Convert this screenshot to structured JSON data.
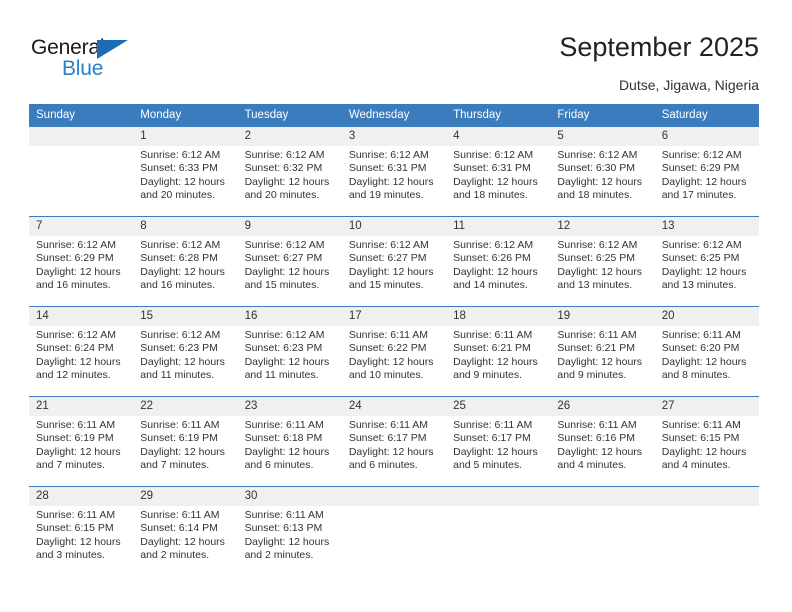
{
  "brand": {
    "name_top": "General",
    "name_bottom": "Blue",
    "triangle_color": "#1b6cb5",
    "text_color": "#2a7fc9"
  },
  "header": {
    "title": "September 2025",
    "subtitle": "Dutse, Jigawa, Nigeria"
  },
  "theme": {
    "header_bg": "#3a7cbe",
    "daynum_bg": "#f0f0f0",
    "text": "#333333"
  },
  "weekday_headers": [
    "Sunday",
    "Monday",
    "Tuesday",
    "Wednesday",
    "Thursday",
    "Friday",
    "Saturday"
  ],
  "weeks": [
    [
      {
        "day": "",
        "sunrise": "",
        "sunset": "",
        "daylight1": "",
        "daylight2": ""
      },
      {
        "day": "1",
        "sunrise": "Sunrise: 6:12 AM",
        "sunset": "Sunset: 6:33 PM",
        "daylight1": "Daylight: 12 hours",
        "daylight2": "and 20 minutes."
      },
      {
        "day": "2",
        "sunrise": "Sunrise: 6:12 AM",
        "sunset": "Sunset: 6:32 PM",
        "daylight1": "Daylight: 12 hours",
        "daylight2": "and 20 minutes."
      },
      {
        "day": "3",
        "sunrise": "Sunrise: 6:12 AM",
        "sunset": "Sunset: 6:31 PM",
        "daylight1": "Daylight: 12 hours",
        "daylight2": "and 19 minutes."
      },
      {
        "day": "4",
        "sunrise": "Sunrise: 6:12 AM",
        "sunset": "Sunset: 6:31 PM",
        "daylight1": "Daylight: 12 hours",
        "daylight2": "and 18 minutes."
      },
      {
        "day": "5",
        "sunrise": "Sunrise: 6:12 AM",
        "sunset": "Sunset: 6:30 PM",
        "daylight1": "Daylight: 12 hours",
        "daylight2": "and 18 minutes."
      },
      {
        "day": "6",
        "sunrise": "Sunrise: 6:12 AM",
        "sunset": "Sunset: 6:29 PM",
        "daylight1": "Daylight: 12 hours",
        "daylight2": "and 17 minutes."
      }
    ],
    [
      {
        "day": "7",
        "sunrise": "Sunrise: 6:12 AM",
        "sunset": "Sunset: 6:29 PM",
        "daylight1": "Daylight: 12 hours",
        "daylight2": "and 16 minutes."
      },
      {
        "day": "8",
        "sunrise": "Sunrise: 6:12 AM",
        "sunset": "Sunset: 6:28 PM",
        "daylight1": "Daylight: 12 hours",
        "daylight2": "and 16 minutes."
      },
      {
        "day": "9",
        "sunrise": "Sunrise: 6:12 AM",
        "sunset": "Sunset: 6:27 PM",
        "daylight1": "Daylight: 12 hours",
        "daylight2": "and 15 minutes."
      },
      {
        "day": "10",
        "sunrise": "Sunrise: 6:12 AM",
        "sunset": "Sunset: 6:27 PM",
        "daylight1": "Daylight: 12 hours",
        "daylight2": "and 15 minutes."
      },
      {
        "day": "11",
        "sunrise": "Sunrise: 6:12 AM",
        "sunset": "Sunset: 6:26 PM",
        "daylight1": "Daylight: 12 hours",
        "daylight2": "and 14 minutes."
      },
      {
        "day": "12",
        "sunrise": "Sunrise: 6:12 AM",
        "sunset": "Sunset: 6:25 PM",
        "daylight1": "Daylight: 12 hours",
        "daylight2": "and 13 minutes."
      },
      {
        "day": "13",
        "sunrise": "Sunrise: 6:12 AM",
        "sunset": "Sunset: 6:25 PM",
        "daylight1": "Daylight: 12 hours",
        "daylight2": "and 13 minutes."
      }
    ],
    [
      {
        "day": "14",
        "sunrise": "Sunrise: 6:12 AM",
        "sunset": "Sunset: 6:24 PM",
        "daylight1": "Daylight: 12 hours",
        "daylight2": "and 12 minutes."
      },
      {
        "day": "15",
        "sunrise": "Sunrise: 6:12 AM",
        "sunset": "Sunset: 6:23 PM",
        "daylight1": "Daylight: 12 hours",
        "daylight2": "and 11 minutes."
      },
      {
        "day": "16",
        "sunrise": "Sunrise: 6:12 AM",
        "sunset": "Sunset: 6:23 PM",
        "daylight1": "Daylight: 12 hours",
        "daylight2": "and 11 minutes."
      },
      {
        "day": "17",
        "sunrise": "Sunrise: 6:11 AM",
        "sunset": "Sunset: 6:22 PM",
        "daylight1": "Daylight: 12 hours",
        "daylight2": "and 10 minutes."
      },
      {
        "day": "18",
        "sunrise": "Sunrise: 6:11 AM",
        "sunset": "Sunset: 6:21 PM",
        "daylight1": "Daylight: 12 hours",
        "daylight2": "and 9 minutes."
      },
      {
        "day": "19",
        "sunrise": "Sunrise: 6:11 AM",
        "sunset": "Sunset: 6:21 PM",
        "daylight1": "Daylight: 12 hours",
        "daylight2": "and 9 minutes."
      },
      {
        "day": "20",
        "sunrise": "Sunrise: 6:11 AM",
        "sunset": "Sunset: 6:20 PM",
        "daylight1": "Daylight: 12 hours",
        "daylight2": "and 8 minutes."
      }
    ],
    [
      {
        "day": "21",
        "sunrise": "Sunrise: 6:11 AM",
        "sunset": "Sunset: 6:19 PM",
        "daylight1": "Daylight: 12 hours",
        "daylight2": "and 7 minutes."
      },
      {
        "day": "22",
        "sunrise": "Sunrise: 6:11 AM",
        "sunset": "Sunset: 6:19 PM",
        "daylight1": "Daylight: 12 hours",
        "daylight2": "and 7 minutes."
      },
      {
        "day": "23",
        "sunrise": "Sunrise: 6:11 AM",
        "sunset": "Sunset: 6:18 PM",
        "daylight1": "Daylight: 12 hours",
        "daylight2": "and 6 minutes."
      },
      {
        "day": "24",
        "sunrise": "Sunrise: 6:11 AM",
        "sunset": "Sunset: 6:17 PM",
        "daylight1": "Daylight: 12 hours",
        "daylight2": "and 6 minutes."
      },
      {
        "day": "25",
        "sunrise": "Sunrise: 6:11 AM",
        "sunset": "Sunset: 6:17 PM",
        "daylight1": "Daylight: 12 hours",
        "daylight2": "and 5 minutes."
      },
      {
        "day": "26",
        "sunrise": "Sunrise: 6:11 AM",
        "sunset": "Sunset: 6:16 PM",
        "daylight1": "Daylight: 12 hours",
        "daylight2": "and 4 minutes."
      },
      {
        "day": "27",
        "sunrise": "Sunrise: 6:11 AM",
        "sunset": "Sunset: 6:15 PM",
        "daylight1": "Daylight: 12 hours",
        "daylight2": "and 4 minutes."
      }
    ],
    [
      {
        "day": "28",
        "sunrise": "Sunrise: 6:11 AM",
        "sunset": "Sunset: 6:15 PM",
        "daylight1": "Daylight: 12 hours",
        "daylight2": "and 3 minutes."
      },
      {
        "day": "29",
        "sunrise": "Sunrise: 6:11 AM",
        "sunset": "Sunset: 6:14 PM",
        "daylight1": "Daylight: 12 hours",
        "daylight2": "and 2 minutes."
      },
      {
        "day": "30",
        "sunrise": "Sunrise: 6:11 AM",
        "sunset": "Sunset: 6:13 PM",
        "daylight1": "Daylight: 12 hours",
        "daylight2": "and 2 minutes."
      },
      {
        "day": "",
        "sunrise": "",
        "sunset": "",
        "daylight1": "",
        "daylight2": ""
      },
      {
        "day": "",
        "sunrise": "",
        "sunset": "",
        "daylight1": "",
        "daylight2": ""
      },
      {
        "day": "",
        "sunrise": "",
        "sunset": "",
        "daylight1": "",
        "daylight2": ""
      },
      {
        "day": "",
        "sunrise": "",
        "sunset": "",
        "daylight1": "",
        "daylight2": ""
      }
    ]
  ]
}
